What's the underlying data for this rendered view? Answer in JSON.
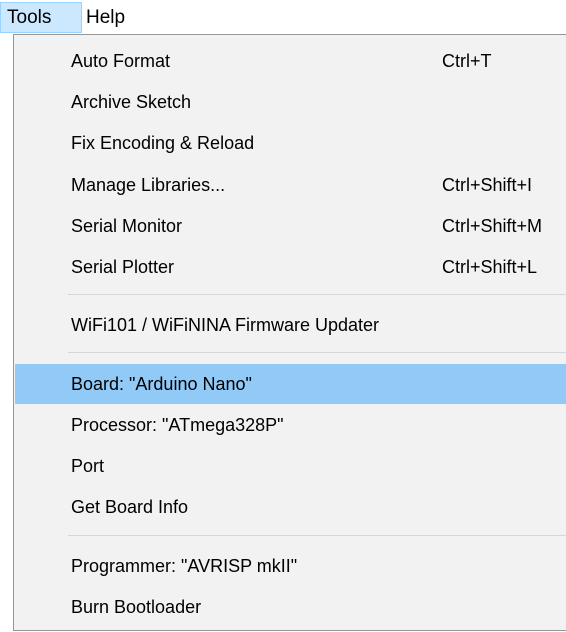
{
  "menubar": {
    "tools_label": "Tools",
    "help_label": "Help"
  },
  "menu": {
    "items": [
      {
        "label": "Auto Format",
        "shortcut": "Ctrl+T"
      },
      {
        "label": "Archive Sketch",
        "shortcut": ""
      },
      {
        "label": "Fix Encoding & Reload",
        "shortcut": ""
      },
      {
        "label": "Manage Libraries...",
        "shortcut": "Ctrl+Shift+I"
      },
      {
        "label": "Serial Monitor",
        "shortcut": "Ctrl+Shift+M"
      },
      {
        "label": "Serial Plotter",
        "shortcut": "Ctrl+Shift+L"
      },
      {
        "label": "WiFi101 / WiFiNINA Firmware Updater",
        "shortcut": ""
      },
      {
        "label": "Board: \"Arduino Nano\"",
        "shortcut": "",
        "selected": true
      },
      {
        "label": "Processor: \"ATmega328P\"",
        "shortcut": ""
      },
      {
        "label": "Port",
        "shortcut": ""
      },
      {
        "label": "Get Board Info",
        "shortcut": ""
      },
      {
        "label": "Programmer: \"AVRISP mkII\"",
        "shortcut": ""
      },
      {
        "label": "Burn Bootloader",
        "shortcut": ""
      }
    ]
  },
  "colors": {
    "menu_background": "#f2f2f2",
    "selected_item": "#91c9f7",
    "active_menubar_item": "#cce8ff"
  }
}
